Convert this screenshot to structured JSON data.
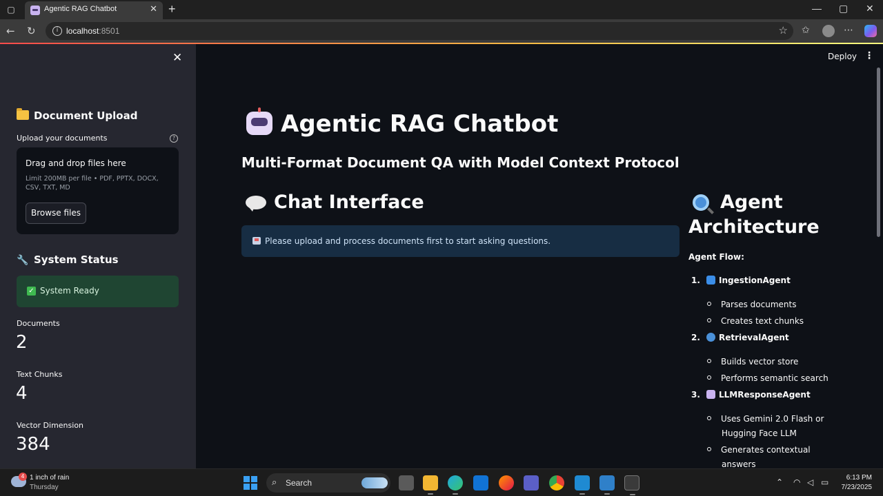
{
  "browser": {
    "tab_title": "Agentic RAG Chatbot",
    "url_host": "localhost",
    "url_port": ":8501",
    "new_tab_label": "+",
    "close_label": "✕"
  },
  "sidebar": {
    "close_label": "✕",
    "upload_heading": "Document Upload",
    "upload_label": "Upload your documents",
    "help_label": "?",
    "dropzone_title": "Drag and drop files here",
    "dropzone_limit": "Limit 200MB per file • PDF, PPTX, DOCX, CSV, TXT, MD",
    "browse_label": "Browse files",
    "status_heading": "System Status",
    "status_text": "System Ready",
    "metrics": [
      {
        "label": "Documents",
        "value": "2"
      },
      {
        "label": "Text Chunks",
        "value": "4"
      },
      {
        "label": "Vector Dimension",
        "value": "384"
      }
    ]
  },
  "header": {
    "deploy_label": "Deploy",
    "menu_label": "⋮"
  },
  "main": {
    "title": "Agentic RAG Chatbot",
    "subtitle": "Multi-Format Document QA with Model Context Protocol",
    "chat_heading": "Chat Interface",
    "info_message": "Please upload and process documents first to start asking questions.",
    "arch_heading": "Agent Architecture",
    "flow_label": "Agent Flow:",
    "agents": [
      {
        "num": "1.",
        "name": "IngestionAgent",
        "icon": "refresh-icon",
        "color": "#3b8ee8",
        "bullets": [
          "Parses documents",
          "Creates text chunks"
        ]
      },
      {
        "num": "2.",
        "name": "RetrievalAgent",
        "icon": "magnifier-icon",
        "color": "#4a90d9",
        "bullets": [
          "Builds vector store",
          "Performs semantic search"
        ]
      },
      {
        "num": "3.",
        "name": "LLMResponseAgent",
        "icon": "robot-icon",
        "color": "#c9b3f0",
        "bullets": [
          "Uses Gemini 2.0 Flash or",
          "Hugging Face LLM",
          "Generates contextual",
          "answers"
        ]
      }
    ]
  },
  "taskbar": {
    "weather_badge": "4",
    "weather_line1": "1 inch of rain",
    "weather_line2": "Thursday",
    "search_label": "Search",
    "time": "6:13 PM",
    "date": "7/23/2025"
  },
  "colors": {
    "app_bg": "#0e1117",
    "sidebar_bg": "#262730",
    "success_bg": "#1f4532",
    "info_bg": "#172d43",
    "accent_red": "#ff4b4b"
  }
}
